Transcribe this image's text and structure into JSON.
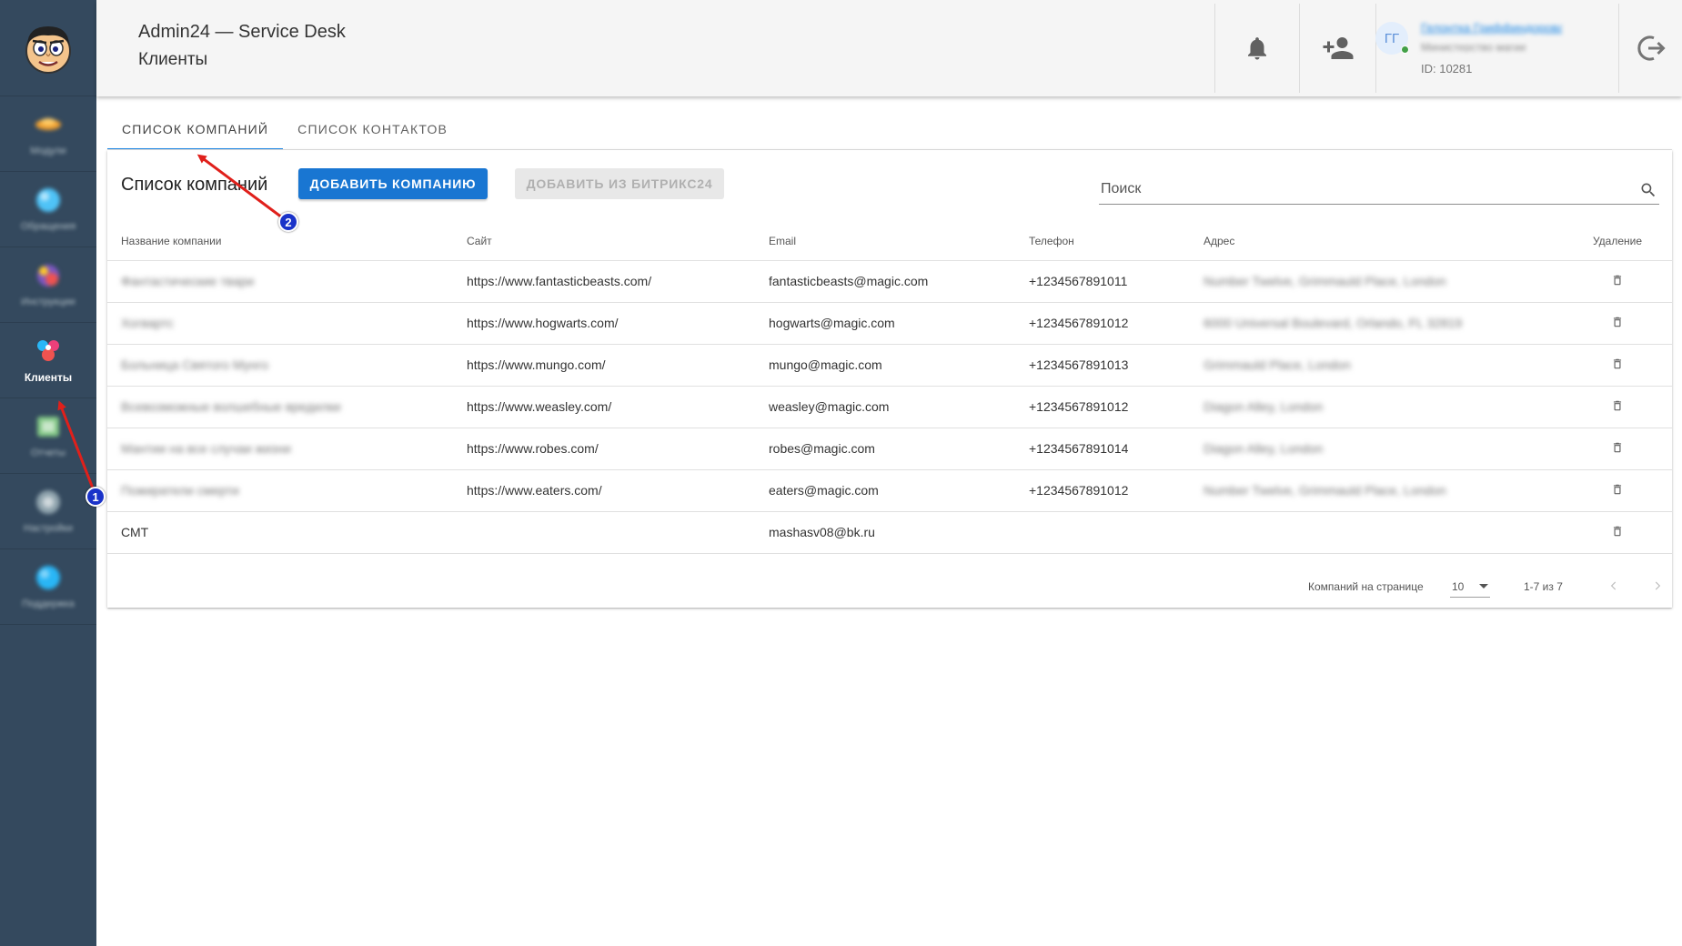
{
  "header": {
    "app_title": "Admin24 — Service Desk",
    "page_subtitle": "Клиенты",
    "user": {
      "initials": "ГГ",
      "name": "Гелонтка Гриффиндорова",
      "role": "Министерство магии",
      "id_text": "ID: 10281"
    }
  },
  "sidebar": {
    "items": [
      {
        "label": "Модули",
        "icon": "modules-icon",
        "active": false
      },
      {
        "label": "Обращения",
        "icon": "tickets-icon",
        "active": false
      },
      {
        "label": "Инструкции",
        "icon": "instructions-icon",
        "active": false
      },
      {
        "label": "Клиенты",
        "icon": "clients-icon",
        "active": true
      },
      {
        "label": "Отчеты",
        "icon": "reports-icon",
        "active": false
      },
      {
        "label": "Настройки",
        "icon": "settings-icon",
        "active": false
      },
      {
        "label": "Поддержка",
        "icon": "support-icon",
        "active": false
      }
    ]
  },
  "tabs": [
    {
      "label": "СПИСОК КОМПАНИЙ",
      "active": true
    },
    {
      "label": "СПИСОК КОНТАКТОВ",
      "active": false
    }
  ],
  "card": {
    "title": "Список компаний",
    "add_button": "ДОБАВИТЬ КОМПАНИЮ",
    "add_bitrix_button": "ДОБАВИТЬ ИЗ БИТРИКС24",
    "search_placeholder": "Поиск"
  },
  "table": {
    "columns": [
      "Название компании",
      "Сайт",
      "Email",
      "Телефон",
      "Адрес",
      "Удаление"
    ],
    "rows": [
      {
        "name": "Фантастические твари",
        "site": "https://www.fantasticbeasts.com/",
        "email": "fantasticbeasts@magic.com",
        "phone": "+1234567891011",
        "address": "Number Twelve, Grimmauld Place, London"
      },
      {
        "name": "Хогвартс",
        "site": "https://www.hogwarts.com/",
        "email": "hogwarts@magic.com",
        "phone": "+1234567891012",
        "address": "6000 Universal Boulevard, Orlando, FL 32819"
      },
      {
        "name": "Больница Святого Мунго",
        "site": "https://www.mungo.com/",
        "email": "mungo@magic.com",
        "phone": "+1234567891013",
        "address": "Grimmauld Place, London"
      },
      {
        "name": "Всевозможные волшебные вредилки",
        "site": "https://www.weasley.com/",
        "email": "weasley@magic.com",
        "phone": "+1234567891012",
        "address": "Diagon Alley, London"
      },
      {
        "name": "Мантии на все случаи жизни",
        "site": "https://www.robes.com/",
        "email": "robes@magic.com",
        "phone": "+1234567891014",
        "address": "Diagon Alley, London"
      },
      {
        "name": "Пожиратели смерти",
        "site": "https://www.eaters.com/",
        "email": "eaters@magic.com",
        "phone": "+1234567891012",
        "address": "Number Twelve, Grimmauld Place, London"
      },
      {
        "name": "СМТ",
        "site": "",
        "email": "mashasv08@bk.ru",
        "phone": "",
        "address": ""
      }
    ]
  },
  "pagination": {
    "rows_per_page_label": "Компаний на странице",
    "rows_per_page_value": "10",
    "range_text": "1-7 из 7"
  },
  "annotations": {
    "badge_1": "1",
    "badge_2": "2"
  },
  "colors": {
    "sidebar_bg": "#34495e",
    "primary": "#1976d2",
    "annotation_arrow": "#e0201b",
    "annotation_badge": "#1a33c9"
  }
}
